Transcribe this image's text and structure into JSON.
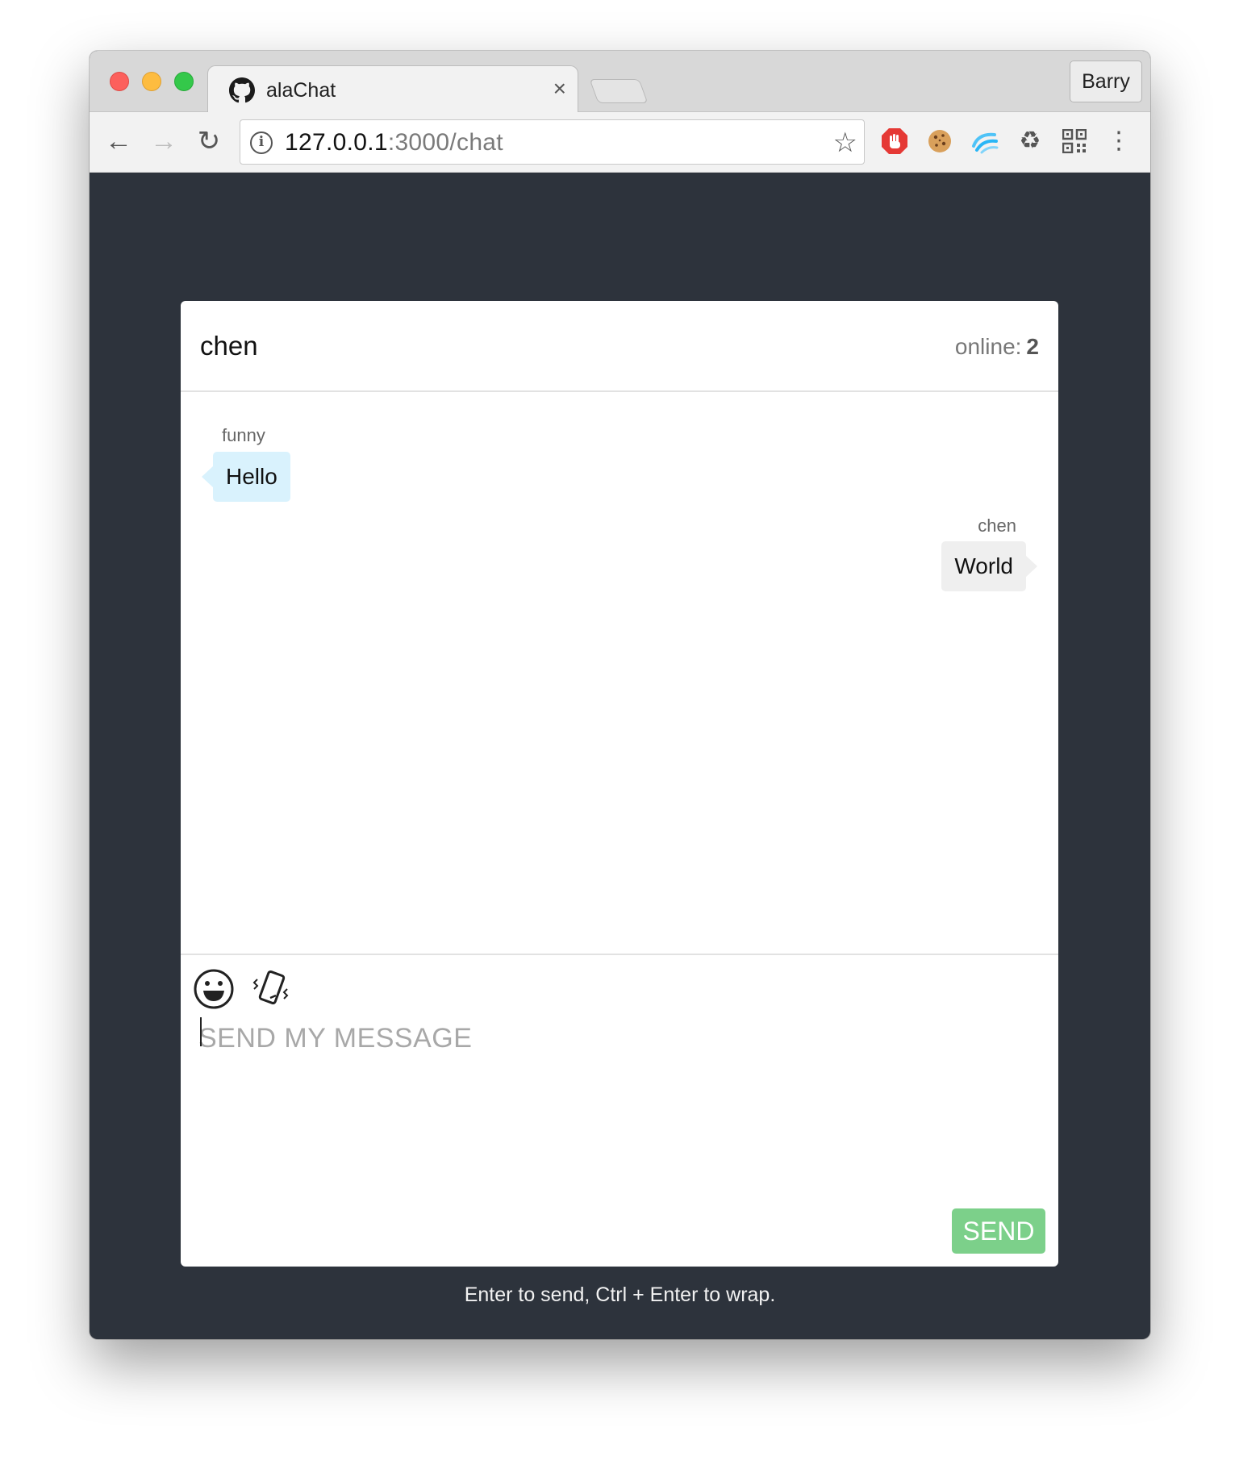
{
  "browser": {
    "tab": {
      "title": "alaChat",
      "close_glyph": "×",
      "icon": "github-icon"
    },
    "profile": "Barry",
    "toolbar": {
      "back_glyph": "←",
      "forward_glyph": "→",
      "reload_glyph": "↻",
      "info_glyph": "i",
      "star_glyph": "☆",
      "more_glyph": "⋮"
    },
    "url": {
      "host": "127.0.0.1",
      "path": ":3000/chat"
    },
    "extensions": [
      {
        "name": "adblock-icon",
        "color": "#e53935"
      },
      {
        "name": "cookie-icon",
        "color": "#c8893b"
      },
      {
        "name": "waves-icon",
        "color": "#4fc3f7"
      },
      {
        "name": "recycle-icon",
        "glyph": "♻"
      },
      {
        "name": "qr-code-icon",
        "color": "#555555"
      }
    ]
  },
  "chat": {
    "room_name": "chen",
    "online_label": "online:",
    "online_count": "2",
    "messages": [
      {
        "author": "funny",
        "text": "Hello",
        "side": "left",
        "bubble_color": "#d9f2fd"
      },
      {
        "author": "chen",
        "text": "World",
        "side": "right",
        "bubble_color": "#efefef"
      }
    ],
    "composer": {
      "placeholder": "SEND MY MESSAGE",
      "send_label": "SEND",
      "send_color": "#7cd08a"
    },
    "hint": "Enter to send, Ctrl + Enter to wrap."
  },
  "colors": {
    "page_background": "#2d333c",
    "card_background": "#ffffff"
  }
}
